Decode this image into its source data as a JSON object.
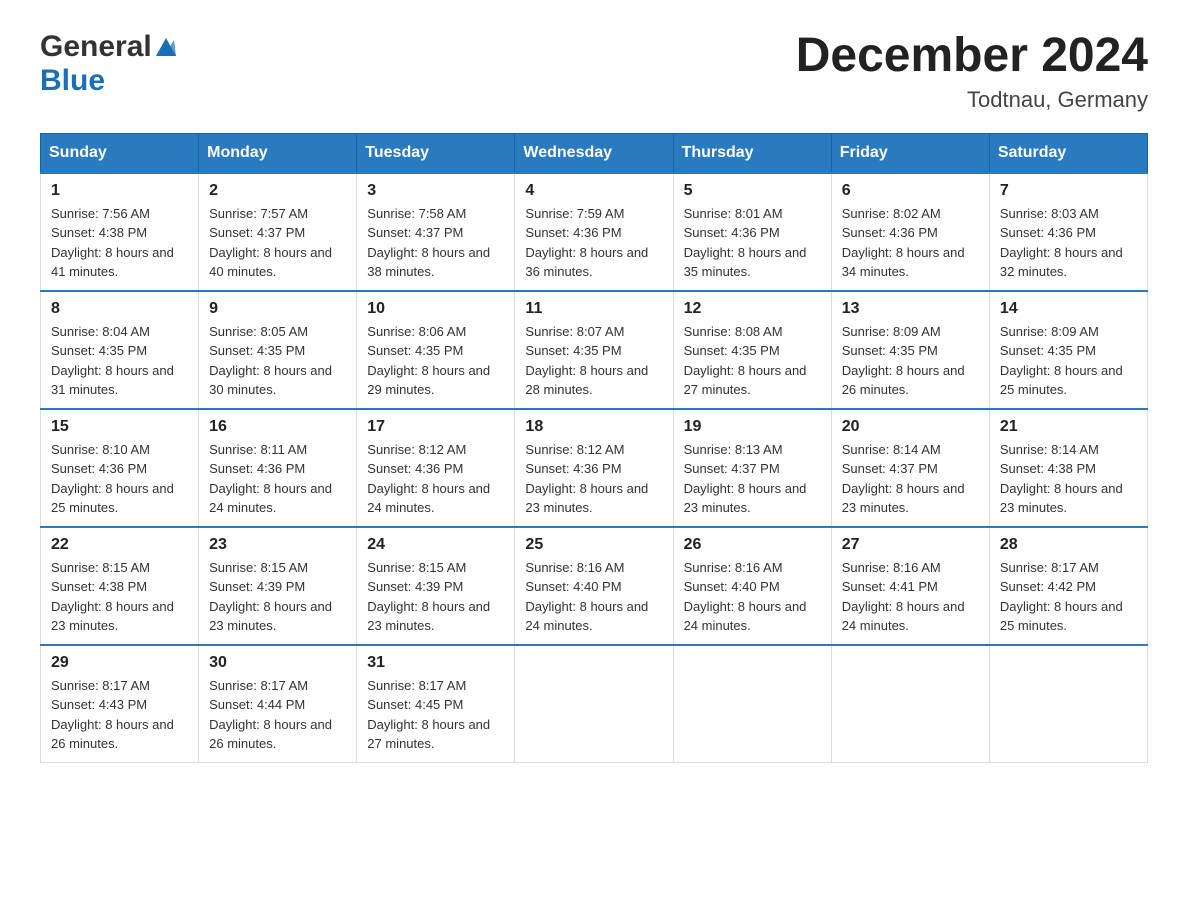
{
  "header": {
    "logo_general": "General",
    "logo_blue": "Blue",
    "title": "December 2024",
    "subtitle": "Todtnau, Germany"
  },
  "calendar": {
    "weekdays": [
      "Sunday",
      "Monday",
      "Tuesday",
      "Wednesday",
      "Thursday",
      "Friday",
      "Saturday"
    ],
    "weeks": [
      [
        {
          "day": "1",
          "sunrise": "7:56 AM",
          "sunset": "4:38 PM",
          "daylight": "8 hours and 41 minutes."
        },
        {
          "day": "2",
          "sunrise": "7:57 AM",
          "sunset": "4:37 PM",
          "daylight": "8 hours and 40 minutes."
        },
        {
          "day": "3",
          "sunrise": "7:58 AM",
          "sunset": "4:37 PM",
          "daylight": "8 hours and 38 minutes."
        },
        {
          "day": "4",
          "sunrise": "7:59 AM",
          "sunset": "4:36 PM",
          "daylight": "8 hours and 36 minutes."
        },
        {
          "day": "5",
          "sunrise": "8:01 AM",
          "sunset": "4:36 PM",
          "daylight": "8 hours and 35 minutes."
        },
        {
          "day": "6",
          "sunrise": "8:02 AM",
          "sunset": "4:36 PM",
          "daylight": "8 hours and 34 minutes."
        },
        {
          "day": "7",
          "sunrise": "8:03 AM",
          "sunset": "4:36 PM",
          "daylight": "8 hours and 32 minutes."
        }
      ],
      [
        {
          "day": "8",
          "sunrise": "8:04 AM",
          "sunset": "4:35 PM",
          "daylight": "8 hours and 31 minutes."
        },
        {
          "day": "9",
          "sunrise": "8:05 AM",
          "sunset": "4:35 PM",
          "daylight": "8 hours and 30 minutes."
        },
        {
          "day": "10",
          "sunrise": "8:06 AM",
          "sunset": "4:35 PM",
          "daylight": "8 hours and 29 minutes."
        },
        {
          "day": "11",
          "sunrise": "8:07 AM",
          "sunset": "4:35 PM",
          "daylight": "8 hours and 28 minutes."
        },
        {
          "day": "12",
          "sunrise": "8:08 AM",
          "sunset": "4:35 PM",
          "daylight": "8 hours and 27 minutes."
        },
        {
          "day": "13",
          "sunrise": "8:09 AM",
          "sunset": "4:35 PM",
          "daylight": "8 hours and 26 minutes."
        },
        {
          "day": "14",
          "sunrise": "8:09 AM",
          "sunset": "4:35 PM",
          "daylight": "8 hours and 25 minutes."
        }
      ],
      [
        {
          "day": "15",
          "sunrise": "8:10 AM",
          "sunset": "4:36 PM",
          "daylight": "8 hours and 25 minutes."
        },
        {
          "day": "16",
          "sunrise": "8:11 AM",
          "sunset": "4:36 PM",
          "daylight": "8 hours and 24 minutes."
        },
        {
          "day": "17",
          "sunrise": "8:12 AM",
          "sunset": "4:36 PM",
          "daylight": "8 hours and 24 minutes."
        },
        {
          "day": "18",
          "sunrise": "8:12 AM",
          "sunset": "4:36 PM",
          "daylight": "8 hours and 23 minutes."
        },
        {
          "day": "19",
          "sunrise": "8:13 AM",
          "sunset": "4:37 PM",
          "daylight": "8 hours and 23 minutes."
        },
        {
          "day": "20",
          "sunrise": "8:14 AM",
          "sunset": "4:37 PM",
          "daylight": "8 hours and 23 minutes."
        },
        {
          "day": "21",
          "sunrise": "8:14 AM",
          "sunset": "4:38 PM",
          "daylight": "8 hours and 23 minutes."
        }
      ],
      [
        {
          "day": "22",
          "sunrise": "8:15 AM",
          "sunset": "4:38 PM",
          "daylight": "8 hours and 23 minutes."
        },
        {
          "day": "23",
          "sunrise": "8:15 AM",
          "sunset": "4:39 PM",
          "daylight": "8 hours and 23 minutes."
        },
        {
          "day": "24",
          "sunrise": "8:15 AM",
          "sunset": "4:39 PM",
          "daylight": "8 hours and 23 minutes."
        },
        {
          "day": "25",
          "sunrise": "8:16 AM",
          "sunset": "4:40 PM",
          "daylight": "8 hours and 24 minutes."
        },
        {
          "day": "26",
          "sunrise": "8:16 AM",
          "sunset": "4:40 PM",
          "daylight": "8 hours and 24 minutes."
        },
        {
          "day": "27",
          "sunrise": "8:16 AM",
          "sunset": "4:41 PM",
          "daylight": "8 hours and 24 minutes."
        },
        {
          "day": "28",
          "sunrise": "8:17 AM",
          "sunset": "4:42 PM",
          "daylight": "8 hours and 25 minutes."
        }
      ],
      [
        {
          "day": "29",
          "sunrise": "8:17 AM",
          "sunset": "4:43 PM",
          "daylight": "8 hours and 26 minutes."
        },
        {
          "day": "30",
          "sunrise": "8:17 AM",
          "sunset": "4:44 PM",
          "daylight": "8 hours and 26 minutes."
        },
        {
          "day": "31",
          "sunrise": "8:17 AM",
          "sunset": "4:45 PM",
          "daylight": "8 hours and 27 minutes."
        },
        null,
        null,
        null,
        null
      ]
    ]
  }
}
